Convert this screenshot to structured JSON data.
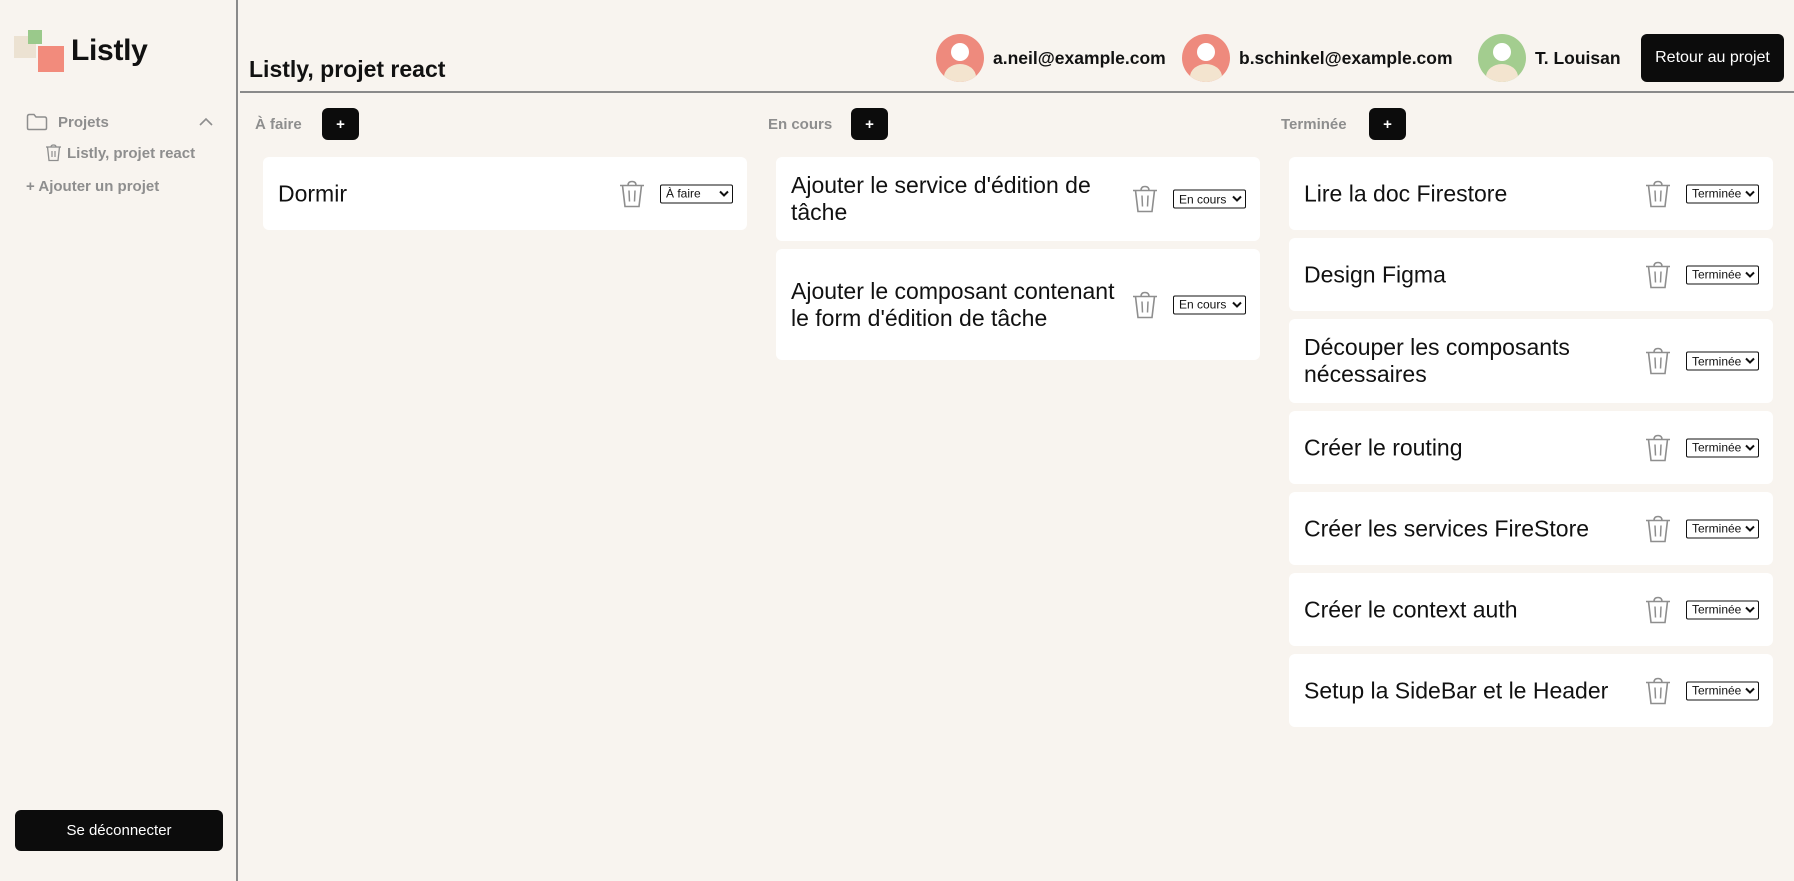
{
  "app": {
    "name": "Listly"
  },
  "colors": {
    "background": "#f8f4ef",
    "button": "#0c0c0c",
    "muted_text": "#8e8e8e",
    "logo_green": "#9ac98b",
    "logo_red": "#f28b7c",
    "logo_beige": "#ece2d2"
  },
  "sidebar": {
    "projects_label": "Projets",
    "projects_icon": "folder-icon",
    "collapse_icon": "chevron-up-icon",
    "project_items": [
      {
        "label": "Listly, projet react",
        "icon": "trash-icon"
      }
    ],
    "add_project": "+ Ajouter un projet",
    "logout": "Se déconnecter"
  },
  "header": {
    "title": "Listly, projet react",
    "members": [
      {
        "name": "a.neil@example.com",
        "avatar_color": "#ee8a7d"
      },
      {
        "name": "b.schinkel@example.com",
        "avatar_color": "#ee8a7d"
      },
      {
        "name": "T. Louisan",
        "avatar_color": "#a3cd8f"
      }
    ],
    "back_button": "Retour au projet"
  },
  "board": {
    "status_options": [
      "À faire",
      "En cours",
      "Terminée"
    ],
    "columns": [
      {
        "title": "À faire",
        "add_label": "+",
        "cards": [
          {
            "title": "Dormir",
            "status": "À faire"
          }
        ]
      },
      {
        "title": "En cours",
        "add_label": "+",
        "cards": [
          {
            "title": "Ajouter le service d'édition de tâche",
            "status": "En cours"
          },
          {
            "title": "Ajouter le composant contenant le form d'édition de tâche",
            "status": "En cours"
          }
        ]
      },
      {
        "title": "Terminée",
        "add_label": "+",
        "cards": [
          {
            "title": "Lire la doc Firestore",
            "status": "Terminée"
          },
          {
            "title": "Design Figma",
            "status": "Terminée"
          },
          {
            "title": "Découper les composants nécessaires",
            "status": "Terminée"
          },
          {
            "title": "Créer le routing",
            "status": "Terminée"
          },
          {
            "title": "Créer les services FireStore",
            "status": "Terminée"
          },
          {
            "title": "Créer le context auth",
            "status": "Terminée"
          },
          {
            "title": "Setup la SideBar et le Header",
            "status": "Terminée"
          }
        ]
      }
    ]
  }
}
